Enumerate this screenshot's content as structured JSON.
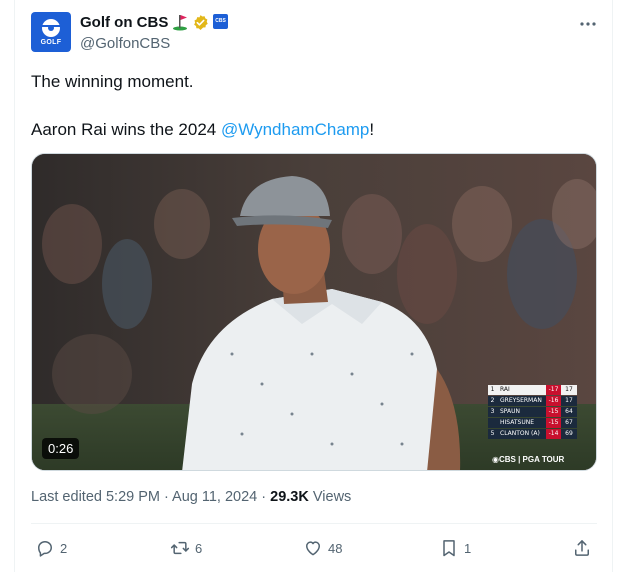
{
  "author": {
    "display_name": "Golf on CBS",
    "handle": "@GolfonCBS",
    "avatar_text": "GOLF",
    "affiliate_badge_text": "CBS"
  },
  "tweet": {
    "line1": "The winning moment.",
    "line2_prefix": "Aaron Rai wins the 2024 ",
    "mention": "@WyndhamChamp",
    "line2_suffix": "!"
  },
  "video": {
    "duration": "0:26",
    "broadcast_logo": "◉CBS | PGA TOUR",
    "leaderboard": [
      {
        "pos": "1",
        "name": "RAI",
        "score": "-17",
        "thru": "17"
      },
      {
        "pos": "2",
        "name": "GREYSERMAN",
        "score": "-16",
        "thru": "17"
      },
      {
        "pos": "3",
        "name": "SPAUN",
        "score": "-15",
        "thru": "64"
      },
      {
        "pos": "",
        "name": "HISATSUNE",
        "score": "-15",
        "thru": "67"
      },
      {
        "pos": "5",
        "name": "CLANTON (A)",
        "score": "-14",
        "thru": "69"
      }
    ]
  },
  "meta": {
    "edited": "Last edited 5:29 PM · Aug 11, 2024 · ",
    "views_count": "29.3K",
    "views_label": " Views"
  },
  "actions": {
    "replies": "2",
    "reposts": "6",
    "likes": "48",
    "bookmarks": "1"
  },
  "colors": {
    "accent": "#1d9bf0",
    "secondary_text": "#536471",
    "verified_gold": "#e2b719",
    "leaderboard_red": "#c8102e",
    "leaderboard_navy": "#1b2a3d"
  }
}
